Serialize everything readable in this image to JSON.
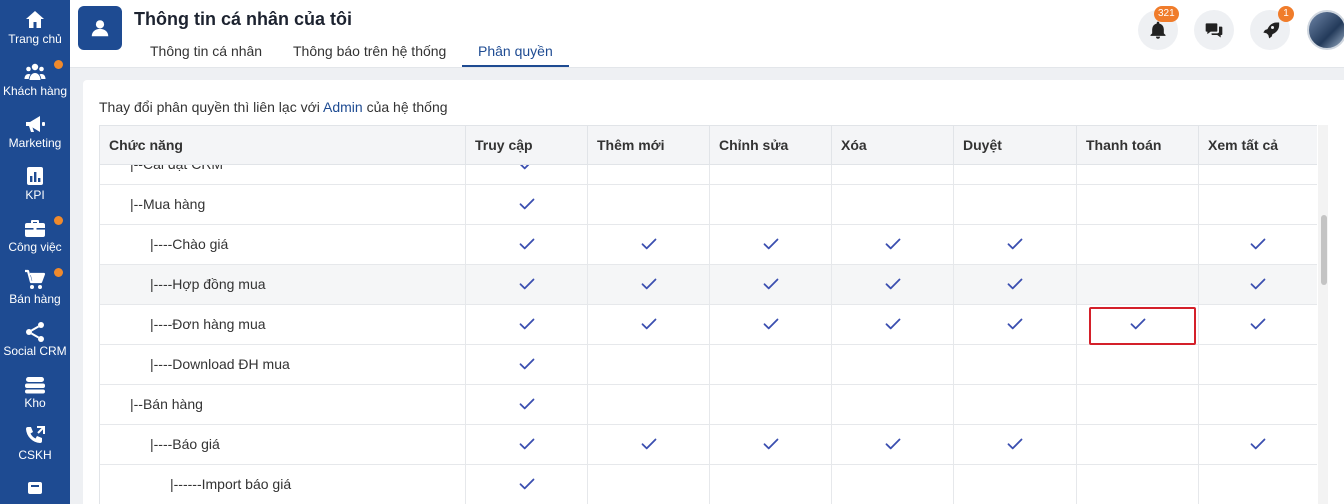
{
  "sidebar": {
    "items": [
      {
        "label": "Trang chủ",
        "icon": "home-icon",
        "dot": false
      },
      {
        "label": "Khách hàng",
        "icon": "users-icon",
        "dot": true
      },
      {
        "label": "Marketing",
        "icon": "megaphone-icon",
        "dot": false
      },
      {
        "label": "KPI",
        "icon": "chart-icon",
        "dot": false
      },
      {
        "label": "Công việc",
        "icon": "briefcase-icon",
        "dot": true
      },
      {
        "label": "Bán hàng",
        "icon": "cart-icon",
        "dot": true
      },
      {
        "label": "Social CRM",
        "icon": "share-icon",
        "dot": false
      },
      {
        "label": "Kho",
        "icon": "warehouse-icon",
        "dot": false
      },
      {
        "label": "CSKH",
        "icon": "phone-icon",
        "dot": false
      },
      {
        "label": "",
        "icon": "more-icon",
        "dot": false
      }
    ]
  },
  "header": {
    "title": "Thông tin cá nhân của tôi",
    "tabs": [
      {
        "label": "Thông tin cá nhân",
        "active": false
      },
      {
        "label": "Thông báo trên hệ thống",
        "active": false
      },
      {
        "label": "Phân quyền",
        "active": true
      }
    ],
    "notification_count": "321",
    "rocket_count": "1"
  },
  "notice": {
    "before": "Thay đổi phân quyền thì liên lạc với ",
    "link": "Admin",
    "after": " của hệ thống"
  },
  "table": {
    "columns": [
      "Chức năng",
      "Truy cập",
      "Thêm mới",
      "Chỉnh sửa",
      "Xóa",
      "Duyệt",
      "Thanh toán",
      "Xem tất cả"
    ],
    "rows": [
      {
        "name": "|--Cài đặt CRM",
        "checks": [
          true,
          false,
          false,
          false,
          false,
          false,
          false
        ]
      },
      {
        "name": "|--Mua hàng",
        "checks": [
          true,
          false,
          false,
          false,
          false,
          false,
          false
        ]
      },
      {
        "name": "|----Chào giá",
        "checks": [
          true,
          true,
          true,
          true,
          true,
          false,
          true
        ]
      },
      {
        "name": "|----Hợp đồng mua",
        "checks": [
          true,
          true,
          true,
          true,
          true,
          false,
          true
        ]
      },
      {
        "name": "|----Đơn hàng mua",
        "checks": [
          true,
          true,
          true,
          true,
          true,
          true,
          true
        ]
      },
      {
        "name": "|----Download ĐH mua",
        "checks": [
          true,
          false,
          false,
          false,
          false,
          false,
          false
        ]
      },
      {
        "name": "|--Bán hàng",
        "checks": [
          true,
          false,
          false,
          false,
          false,
          false,
          false
        ]
      },
      {
        "name": "|----Báo giá",
        "checks": [
          true,
          true,
          true,
          true,
          true,
          false,
          true
        ]
      },
      {
        "name": "|------Import báo giá",
        "checks": [
          true,
          false,
          false,
          false,
          false,
          false,
          false
        ]
      }
    ]
  },
  "colors": {
    "sidebar": "#1e4b92",
    "accent": "#1e4b92",
    "check": "#3b4fb0",
    "badge": "#f07c2b",
    "highlight": "#d4202a"
  }
}
